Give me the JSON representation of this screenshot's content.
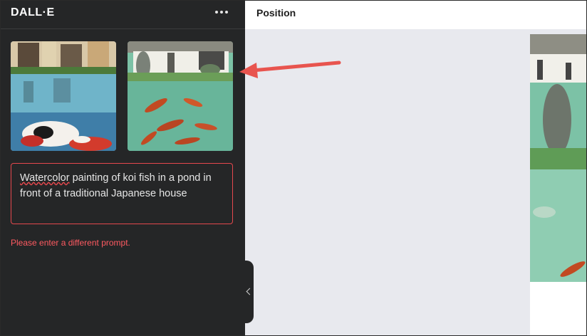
{
  "sidebar": {
    "title": "DALL·E",
    "more_icon": "more-horizontal-icon",
    "prompt_prefix": "Watercolor",
    "prompt_rest": " painting of koi fish in a pond in front of a traditional Japanese house",
    "error": "Please enter a different prompt.",
    "collapse_icon": "chevron-left-icon"
  },
  "toolbar": {
    "position_label": "Position"
  },
  "colors": {
    "sidebar_bg": "#252627",
    "error": "#ff5a61",
    "arrow": "#e8544e",
    "canvas_bg": "#e8e9ee"
  },
  "annotation": {
    "icon": "red-arrow-icon"
  }
}
